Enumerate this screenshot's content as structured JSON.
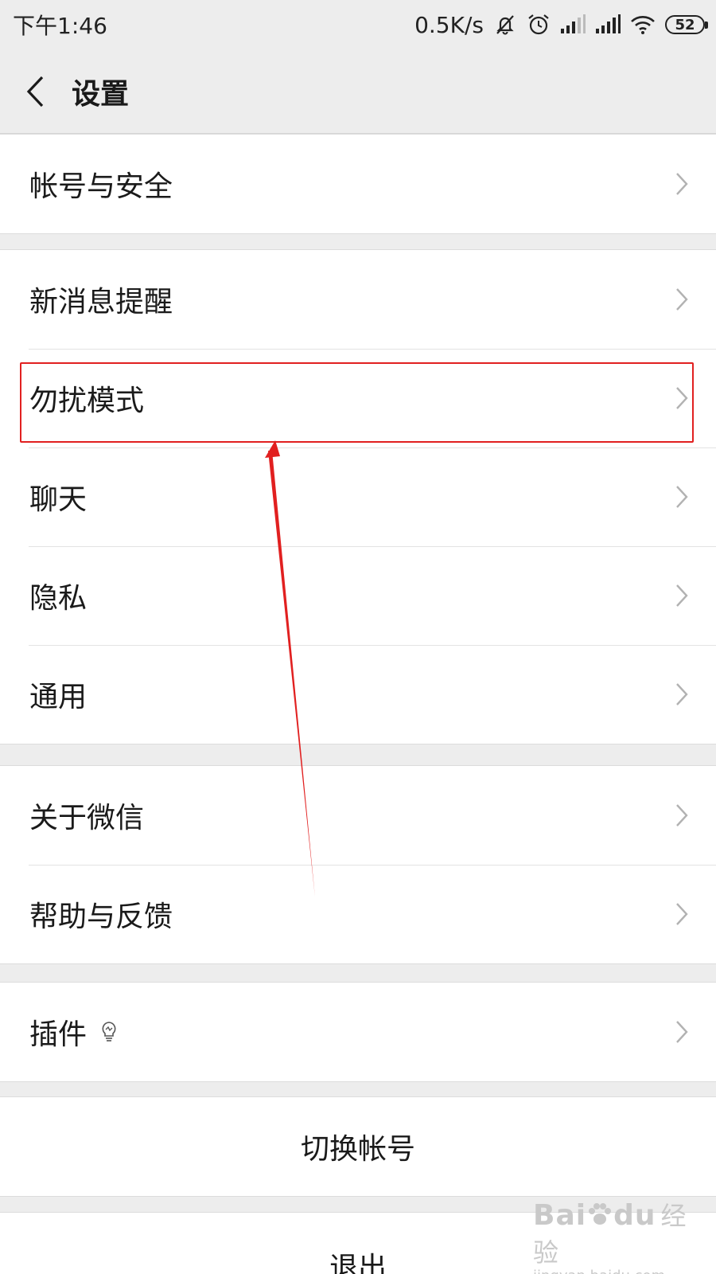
{
  "status_bar": {
    "time": "下午1:46",
    "net_speed": "0.5K/s",
    "battery": "52",
    "icons": [
      "mute-bell-icon",
      "alarm-icon",
      "signal-icon",
      "signal-icon",
      "wifi-icon",
      "battery-icon"
    ]
  },
  "header": {
    "title": "设置",
    "back_icon": "chevron-left-icon"
  },
  "groups": [
    {
      "items": [
        {
          "label": "帐号与安全"
        }
      ]
    },
    {
      "items": [
        {
          "label": "新消息提醒"
        },
        {
          "label": "勿扰模式"
        },
        {
          "label": "聊天"
        },
        {
          "label": "隐私"
        },
        {
          "label": "通用"
        }
      ]
    },
    {
      "items": [
        {
          "label": "关于微信"
        },
        {
          "label": "帮助与反馈"
        }
      ]
    },
    {
      "items": [
        {
          "label": "插件",
          "icon": "lightbulb-icon"
        }
      ]
    }
  ],
  "actions": {
    "switch_account": "切换帐号",
    "logout": "退出"
  },
  "annotation": {
    "highlight_color": "#e12020",
    "highlighted_item": "勿扰模式"
  },
  "watermark": {
    "brand_latin": "Bai",
    "brand_suffix": "du",
    "brand_cn": "经验",
    "url": "jingyan.baidu.com"
  },
  "colors": {
    "background": "#ededed",
    "surface": "#ffffff",
    "text": "#1a1a1a",
    "chevron": "#b2b2b2"
  }
}
